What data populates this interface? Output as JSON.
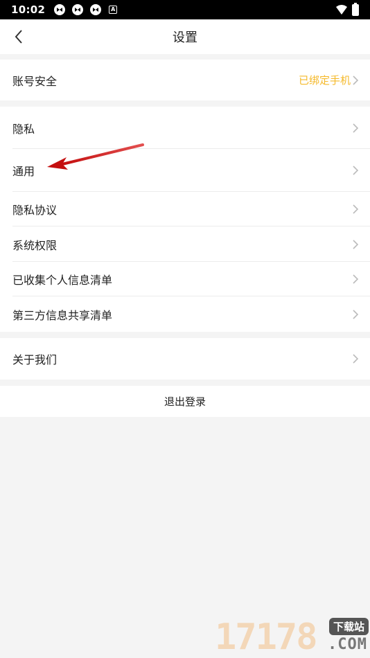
{
  "status_bar": {
    "time": "10:02",
    "app_icons": [
      "app-icon",
      "app-icon",
      "app-icon"
    ],
    "a_label": "A"
  },
  "nav": {
    "title": "设置"
  },
  "sections": {
    "account": {
      "label": "账号安全",
      "value": "已绑定手机"
    },
    "privacy": [
      {
        "label": "隐私"
      },
      {
        "label": "通用"
      },
      {
        "label": "隐私协议"
      },
      {
        "label": "系统权限"
      },
      {
        "label": "已收集个人信息清单"
      },
      {
        "label": "第三方信息共享清单"
      }
    ],
    "about": {
      "label": "关于我们"
    }
  },
  "logout": {
    "label": "退出登录"
  },
  "watermark": {
    "digits": "17178",
    "badge": "下载站",
    "domain": ".COM"
  },
  "colors": {
    "accent_value": "#f5b92a",
    "annotation_arrow": "#d41a1a"
  }
}
